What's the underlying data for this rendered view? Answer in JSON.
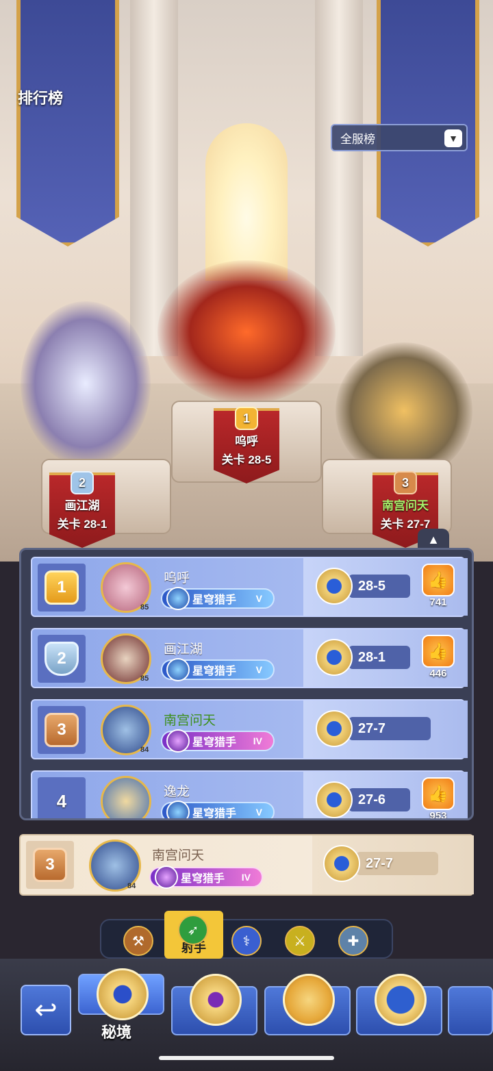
{
  "header": {
    "title": "排行榜",
    "server_filter": "全服榜"
  },
  "podium": [
    {
      "rank": "2",
      "name": "画江湖",
      "stage": "关卡 28-1",
      "name_color": "#ffffff"
    },
    {
      "rank": "1",
      "name": "呜呼",
      "stage": "关卡 28-5",
      "name_color": "#ffffff"
    },
    {
      "rank": "3",
      "name": "南宫问天",
      "stage": "关卡 27-7",
      "name_color": "#a7f06a"
    }
  ],
  "list": {
    "rows": [
      {
        "rank": "1",
        "name": "呜呼",
        "level": "85",
        "title": "星穹猎手",
        "tier": "V",
        "stage": "28-5",
        "likes": "741",
        "name_color": "white"
      },
      {
        "rank": "2",
        "name": "画江湖",
        "level": "85",
        "title": "星穹猎手",
        "tier": "V",
        "stage": "28-1",
        "likes": "446",
        "name_color": "white"
      },
      {
        "rank": "3",
        "name": "南宫问天",
        "level": "84",
        "title": "星穹猎手",
        "tier": "IV",
        "stage": "27-7",
        "likes": "",
        "name_color": "green"
      },
      {
        "rank": "4",
        "name": "逸龙",
        "level": "",
        "title": "星穹猎手",
        "tier": "V",
        "stage": "27-6",
        "likes": "953",
        "name_color": "white"
      }
    ]
  },
  "my_rank": {
    "rank": "3",
    "name": "南宫问天",
    "level": "84",
    "title": "星穹猎手",
    "tier": "IV",
    "stage": "27-7"
  },
  "class_filter": {
    "items": [
      "warrior-axe-icon",
      "archer-bow-icon",
      "mage-staff-icon",
      "assassin-blade-icon",
      "support-cross-icon"
    ],
    "active_label": "射手"
  },
  "bottom_nav": {
    "active_label": "秘境",
    "tabs": [
      "secret-realm-icon",
      "eye-rune-icon",
      "crown-icon",
      "compass-star-icon",
      "extra-icon"
    ]
  },
  "colors": {
    "accent_gold": "#e7b84a",
    "row_blue": "#8ea7ea",
    "my_row_beige": "#f3e6d3",
    "podium_red": "#b9282a"
  }
}
